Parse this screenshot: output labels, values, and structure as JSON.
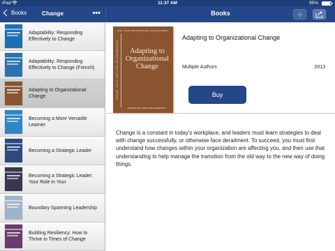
{
  "status_bar": {
    "carrier": "iPad",
    "time": "11:37 AM",
    "battery": "95%"
  },
  "left_nav": {
    "back_label": "Books",
    "title": "Change",
    "more_glyph": "•••"
  },
  "right_nav": {
    "title": "Books"
  },
  "list": [
    {
      "label": "Adaptability: Responding Effectively to Change",
      "color": "#1f6fb5"
    },
    {
      "label": "Adaptability: Responding Effectively to Change (French)",
      "color": "#2a74ad"
    },
    {
      "label": "Adapting to Organizational Change",
      "color": "#8a5430"
    },
    {
      "label": "Becoming a More Versatile Learner",
      "color": "#2d86c8"
    },
    {
      "label": "Becoming a Strategic Leader",
      "color": "#2c4a80"
    },
    {
      "label": "Becoming a Strategic Leader: Your Role in Your",
      "color": "#3b3550"
    },
    {
      "label": "Boundary Spanning Leadership",
      "color": "#9fb4c8"
    },
    {
      "label": "Building Resiliency: How to Thrive in Times of Change",
      "color": "#6a3c6e"
    }
  ],
  "book": {
    "title": "Adapting to Organizational Change",
    "author": "Multiple Authors",
    "year": "2013",
    "buy_label": "Buy",
    "cover": {
      "top_line": "FOR YOUR PROFESSIONAL DEVELOPMENT",
      "spine_text": "IDEAS INTO ACTION GUIDEBOOKS",
      "title": "Adapting to Organizational Change",
      "subtitle": "CENTER FOR CREATIVE LEADERSHIP",
      "color": "#8a5430"
    },
    "description": "Change is a constant in today's workplace, and leaders must learn strategies to deal with change successfully, or otherwise face derailment. To succeed, you must first understand how changes within your organization are affecting you, and then use that understanding to help manage the transition from the old way to the new way of doing things."
  },
  "colors": {
    "nav_bar": "#24478a",
    "status_bar": "#1d3e76",
    "buy_button": "#24478a"
  }
}
